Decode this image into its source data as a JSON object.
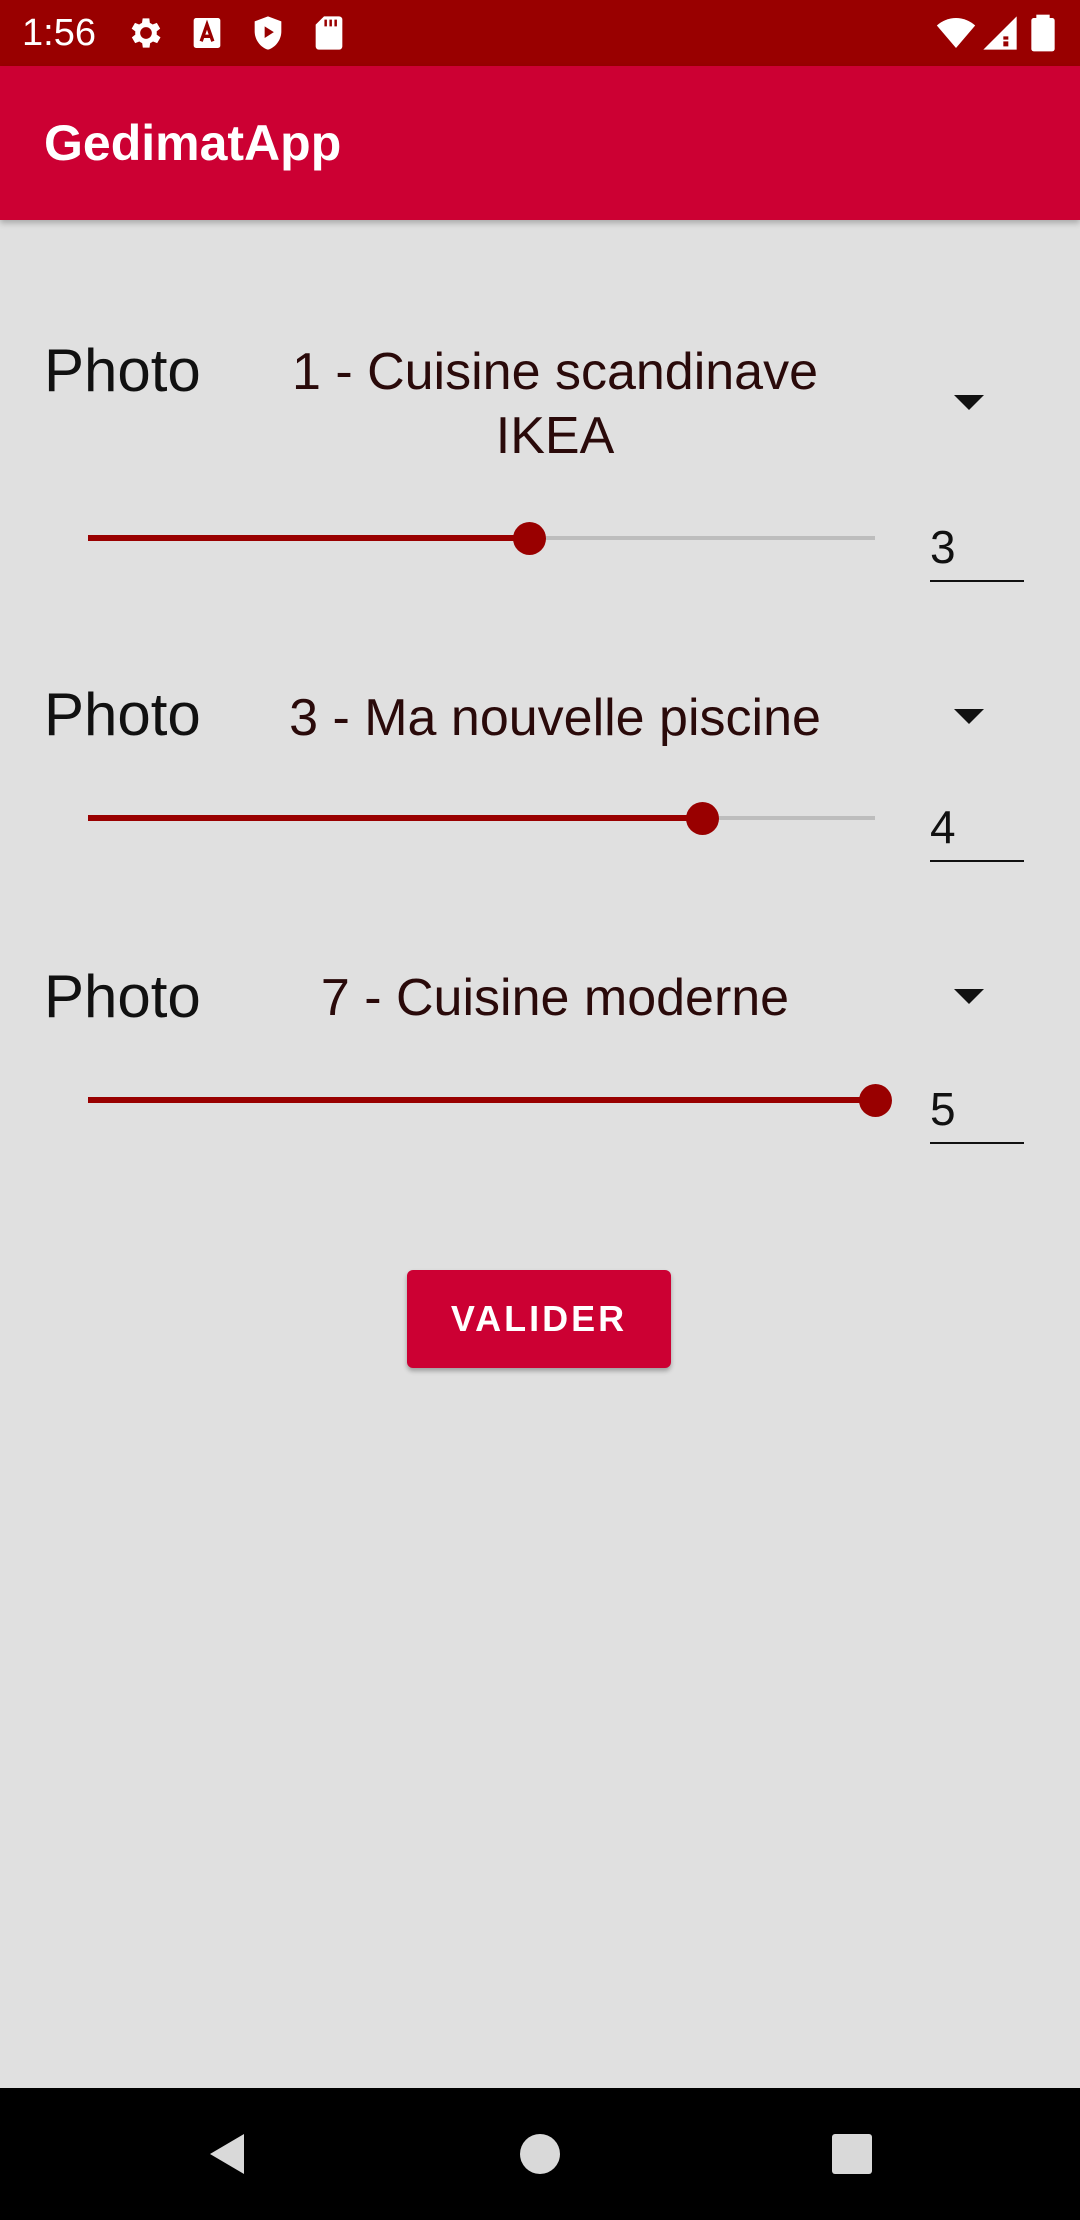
{
  "status_bar": {
    "time": "1:56",
    "left_icons": [
      "gear-icon",
      "text-a-icon",
      "shield-play-icon",
      "sd-card-icon"
    ],
    "right_icons": [
      "wifi-icon",
      "cell-signal-icon",
      "battery-icon"
    ],
    "background": "#990000"
  },
  "app_bar": {
    "title": "GedimatApp",
    "background": "#cc0033"
  },
  "ratings": [
    {
      "label": "Photo",
      "selection": "1  -  Cuisine scandinave IKEA",
      "value": "3",
      "slider_fraction": 0.56
    },
    {
      "label": "Photo",
      "selection": "3  -  Ma nouvelle piscine",
      "value": "4",
      "slider_fraction": 0.78
    },
    {
      "label": "Photo",
      "selection": "7  -  Cuisine moderne",
      "value": "5",
      "slider_fraction": 1.0
    }
  ],
  "submit": {
    "label": "VALIDER"
  },
  "accent_color": "#990000",
  "nav_bar": {
    "buttons": [
      "back-icon",
      "home-icon",
      "recents-icon"
    ]
  }
}
